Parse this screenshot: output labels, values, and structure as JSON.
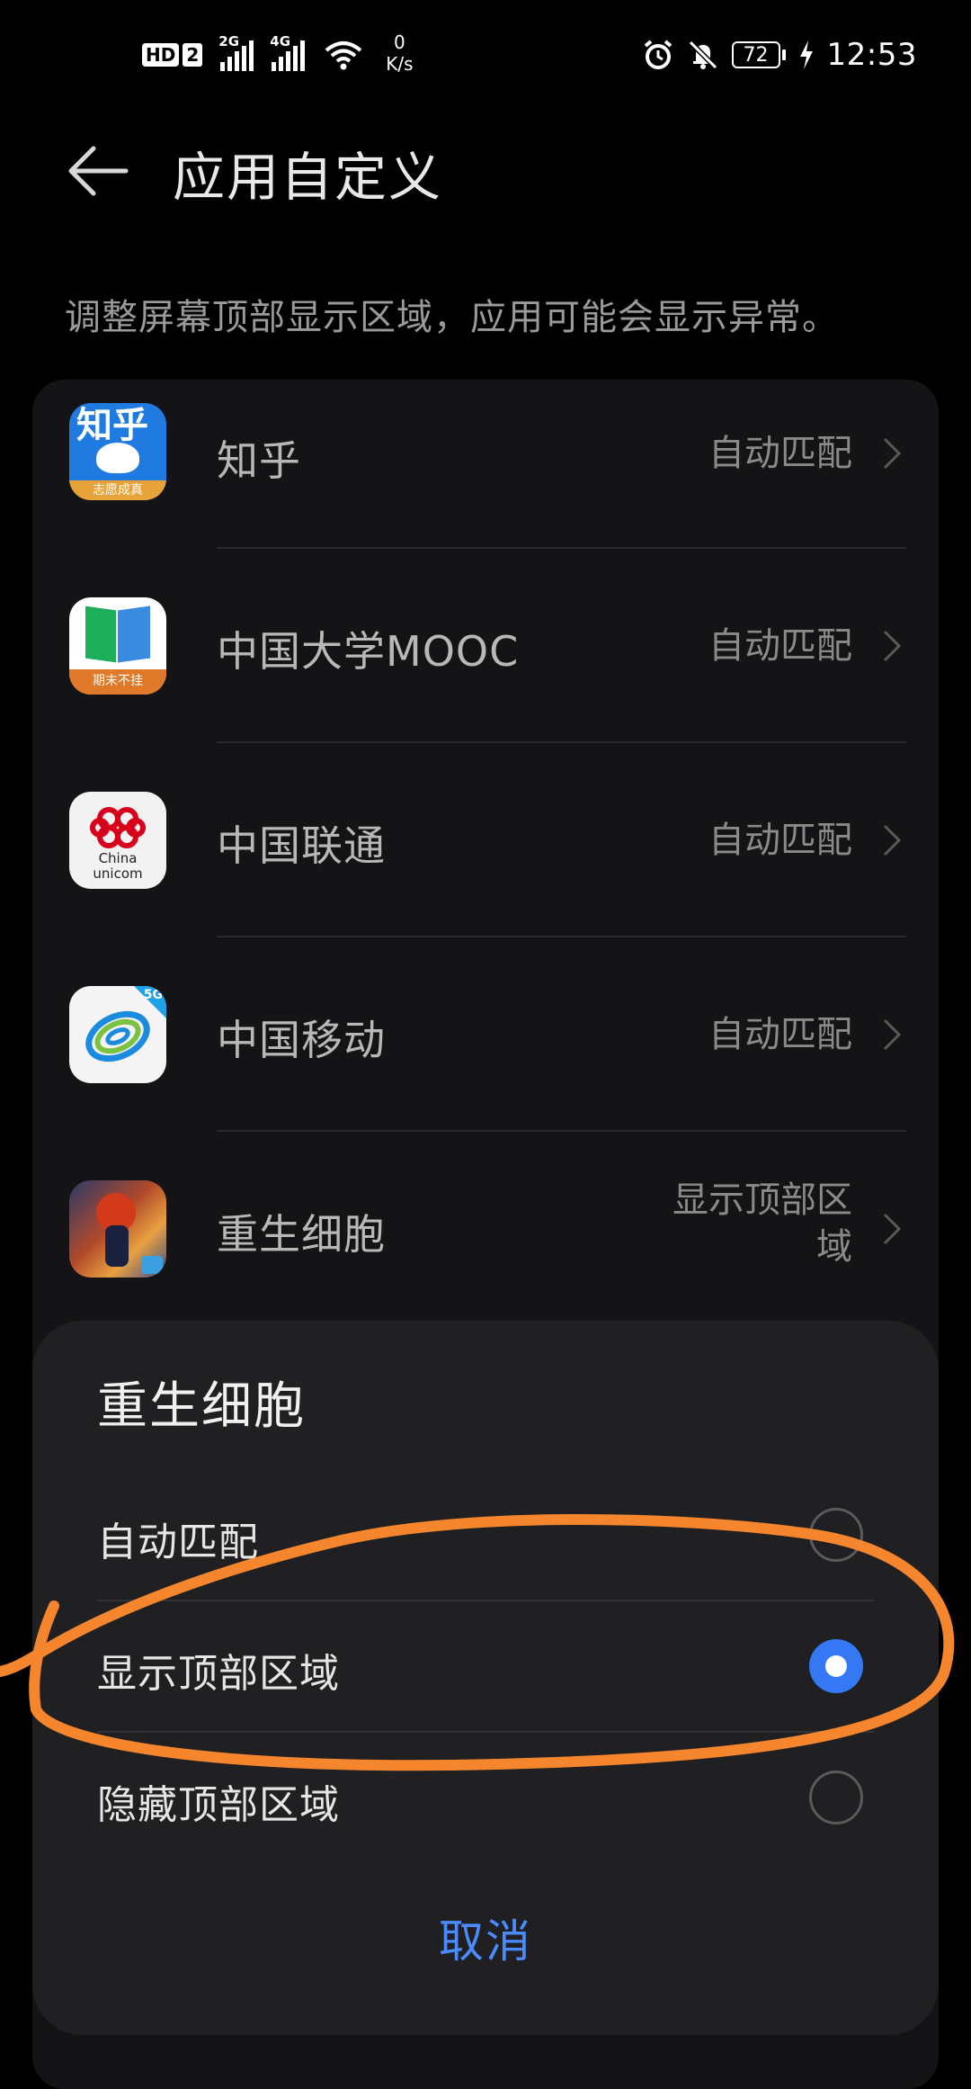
{
  "status_bar": {
    "hd_label": "HD",
    "hd_sim": "2",
    "sim1_network": "2G",
    "sim2_network": "4G",
    "speed_value": "0",
    "speed_unit": "K/s",
    "battery_level": "72",
    "time": "12:53",
    "icons": [
      "wifi-icon",
      "alarm-icon",
      "bell-off-icon",
      "battery-icon",
      "charging-icon"
    ]
  },
  "header": {
    "title": "应用自定义",
    "back_icon": "arrow-left-icon"
  },
  "description": "调整屏幕顶部显示区域，应用可能会显示异常。",
  "apps": [
    {
      "name": "知乎",
      "setting": "自动匹配",
      "icon": "zhihu-app-icon",
      "icon_text": "知乎",
      "icon_subtext": "志愿成真"
    },
    {
      "name": "中国大学MOOC",
      "setting": "自动匹配",
      "icon": "mooc-app-icon",
      "icon_subtext": "期末不挂"
    },
    {
      "name": "中国联通",
      "setting": "自动匹配",
      "icon": "china-unicom-app-icon",
      "icon_text": "China unicom"
    },
    {
      "name": "中国移动",
      "setting": "自动匹配",
      "icon": "china-mobile-app-icon",
      "icon_badge": "5G"
    },
    {
      "name": "重生细胞",
      "setting_line1": "显示顶部区",
      "setting_line2": "域",
      "icon": "dead-cells-app-icon"
    }
  ],
  "dialog": {
    "title": "重生细胞",
    "options": [
      {
        "label": "自动匹配",
        "selected": false
      },
      {
        "label": "显示顶部区域",
        "selected": true
      },
      {
        "label": "隐藏顶部区域",
        "selected": false
      }
    ],
    "cancel": "取消"
  },
  "colors": {
    "background": "#000000",
    "list_background": "#141416",
    "sheet_background": "#202022",
    "accent_blue": "#3478f6",
    "cancel_text": "#4a8cff",
    "annotation_orange": "#f5862e"
  }
}
